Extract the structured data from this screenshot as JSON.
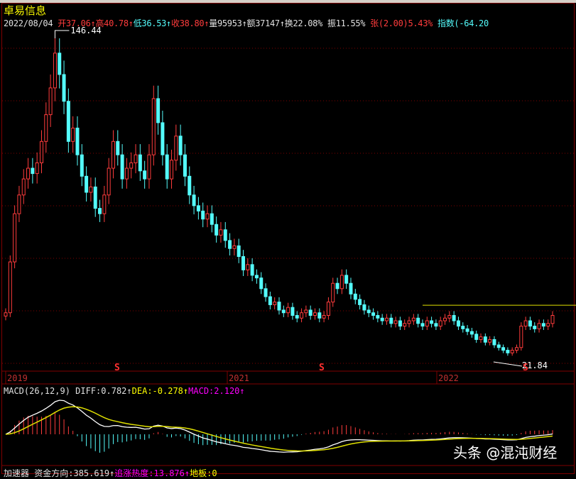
{
  "stock": {
    "name": "卓易信息"
  },
  "quote": {
    "date": "2022/08/04",
    "open_label": "开",
    "open": "37.06",
    "high_label": "高",
    "high": "40.78",
    "low_label": "低",
    "low": "36.53",
    "close_label": "收",
    "close": "38.80",
    "volume_label": "量",
    "volume": "95953",
    "amount_label": "额",
    "amount": "37147",
    "turnover_label": "换",
    "turnover": "22.08%",
    "amplitude_label": "振",
    "amplitude": "11.55%",
    "change_label": "张",
    "change": "(2.00)5.43%",
    "index_label": "指数",
    "index": "(-64.20"
  },
  "arrow": "↑",
  "annotations": {
    "max_price": "146.44",
    "min_price": "21.84",
    "signal": "S"
  },
  "date_axis": [
    "2019",
    "2021",
    "2022"
  ],
  "macd": {
    "label": "MACD(26,12,9)",
    "diff_label": "DIFF:",
    "diff": "0.782",
    "dea_label": "DEA:",
    "dea": "-0.278",
    "macd_label": "MACD:",
    "macd": "2.120"
  },
  "bottom": {
    "name": "加速器",
    "fund_label": "资金方向:",
    "fund": "385.619",
    "heat_label": "追涨热度:",
    "heat": "13.876",
    "floor_label": "地板:",
    "floor": "0"
  },
  "watermark": "头条 @混沌财经",
  "colors": {
    "up": "#ff3c3c",
    "down": "#54fcfc",
    "grid": "#800000",
    "diff": "#ffffff",
    "dea": "#e0e000",
    "resistance": "#e0e000"
  },
  "chart_data": {
    "type": "candlestick",
    "price_range": [
      21.84,
      146.44
    ],
    "resistance_price": 43.8,
    "closes": [
      41,
      60,
      78,
      85,
      91,
      95,
      93,
      97,
      105,
      115,
      125,
      138,
      130,
      120,
      105,
      110,
      100,
      92,
      86,
      88,
      80,
      78,
      85,
      95,
      105,
      100,
      91,
      95,
      97,
      100,
      94,
      91,
      100,
      121,
      112,
      100,
      91,
      98,
      107,
      100,
      92,
      85,
      81,
      79,
      76,
      78,
      74,
      70,
      72,
      68,
      65,
      66,
      62,
      57,
      59,
      55,
      54,
      50,
      47,
      44,
      45,
      42,
      41,
      43,
      40,
      39,
      41,
      42,
      40,
      41,
      39,
      40,
      45,
      52,
      50,
      55,
      52,
      48,
      46,
      44,
      42,
      41,
      40,
      39,
      38,
      39,
      37,
      38,
      36,
      37,
      38,
      39,
      37,
      36,
      38,
      37,
      36,
      38,
      39,
      40,
      38,
      36,
      35,
      34,
      33,
      31,
      32,
      30,
      31,
      29,
      28,
      27,
      26,
      27,
      28,
      36,
      38,
      36,
      35,
      37,
      36,
      37,
      40
    ]
  }
}
